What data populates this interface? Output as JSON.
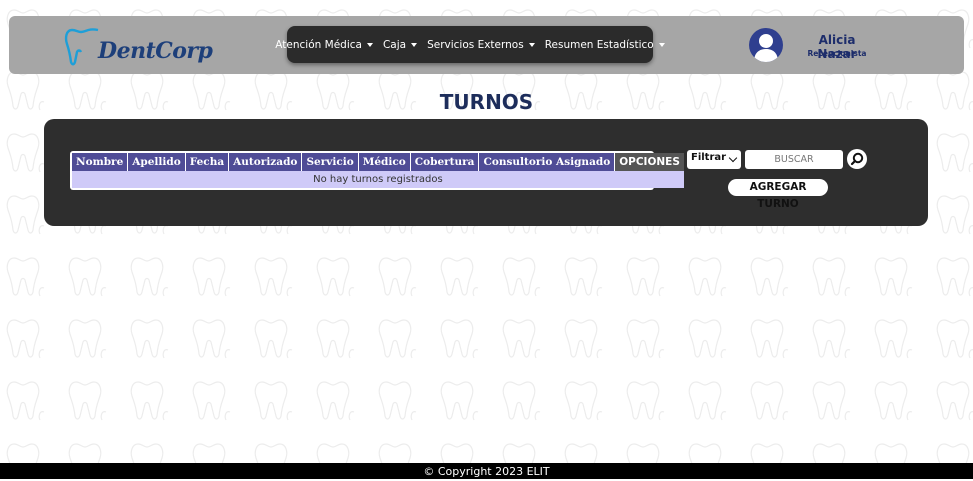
{
  "brand": {
    "logo_text": "DentCorp"
  },
  "nav": {
    "items": [
      {
        "label": "Atención Médica"
      },
      {
        "label": "Caja"
      },
      {
        "label": "Servicios Externos"
      },
      {
        "label": "Resumen Estadístico"
      }
    ]
  },
  "user": {
    "name": "Alicia Nazar",
    "role": "Recepcionista"
  },
  "page": {
    "title": "TURNOS"
  },
  "table": {
    "columns": [
      "Nombre",
      "Apellido",
      "Fecha",
      "Autorizado",
      "Servicio",
      "Médico",
      "Cobertura",
      "Consultorio Asignado",
      "OPCIONES"
    ],
    "empty_message": "No hay turnos registrados"
  },
  "controls": {
    "filter_label": "Filtrar",
    "search_placeholder": "BUSCAR",
    "add_label": "AGREGAR TURNO"
  },
  "footer": {
    "text": "© Copyright 2023 ELIT"
  },
  "colors": {
    "navbar": "#a6a6a6",
    "menu": "#2b2b2b",
    "panel": "#2e2e2e",
    "table_header": "#4f4c96",
    "options_header": "#555555",
    "empty_row": "#cfcaf8",
    "brand_blue": "#1d3f7a",
    "title": "#1d2d5b"
  },
  "icons": [
    "tooth-pattern-background",
    "tooth-logo-icon",
    "user-avatar-icon",
    "caret-down-icon",
    "search-icon"
  ]
}
